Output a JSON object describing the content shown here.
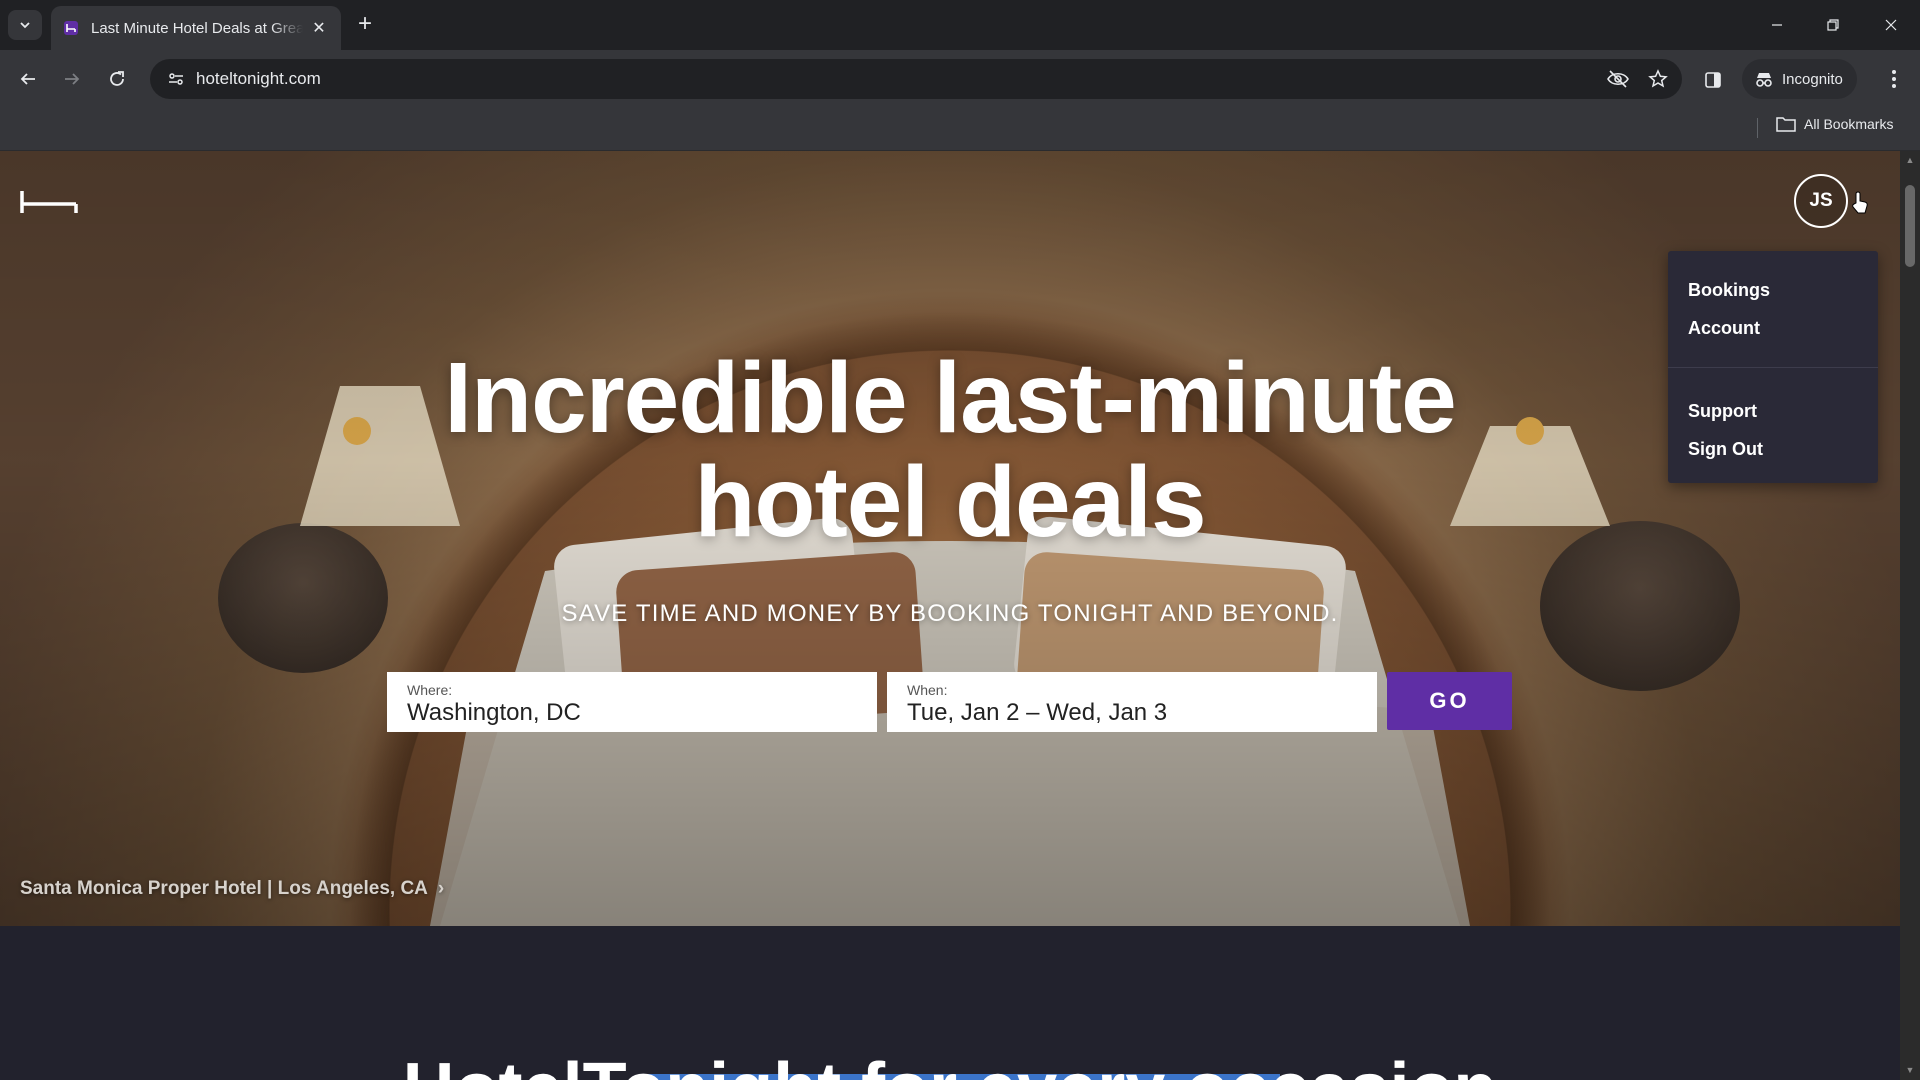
{
  "browser": {
    "tab_title": "Last Minute Hotel Deals at Great Prices",
    "url": "hoteltonight.com",
    "profile_label": "Incognito",
    "bookmarks_label": "All Bookmarks"
  },
  "page": {
    "avatar_initials": "JS",
    "user_menu": {
      "items": [
        "Bookings",
        "Account",
        "Support",
        "Sign Out"
      ]
    },
    "headline_line1": "Incredible last-minute",
    "headline_line2": "hotel deals",
    "subheadline": "SAVE TIME AND MONEY BY BOOKING TONIGHT AND BEYOND.",
    "search": {
      "where_label": "Where:",
      "where_value": "Washington, DC",
      "when_label": "When:",
      "when_value": "Tue, Jan 2 – Wed, Jan 3",
      "go_label": "GO"
    },
    "hotel_credit": "Santa Monica Proper Hotel | Los Angeles, CA",
    "section_title": "HotelTonight for every occasion"
  },
  "colors": {
    "brand_purple": "#5f2ea5",
    "page_dark": "#22222d",
    "selection_blue": "#3b74c9"
  }
}
